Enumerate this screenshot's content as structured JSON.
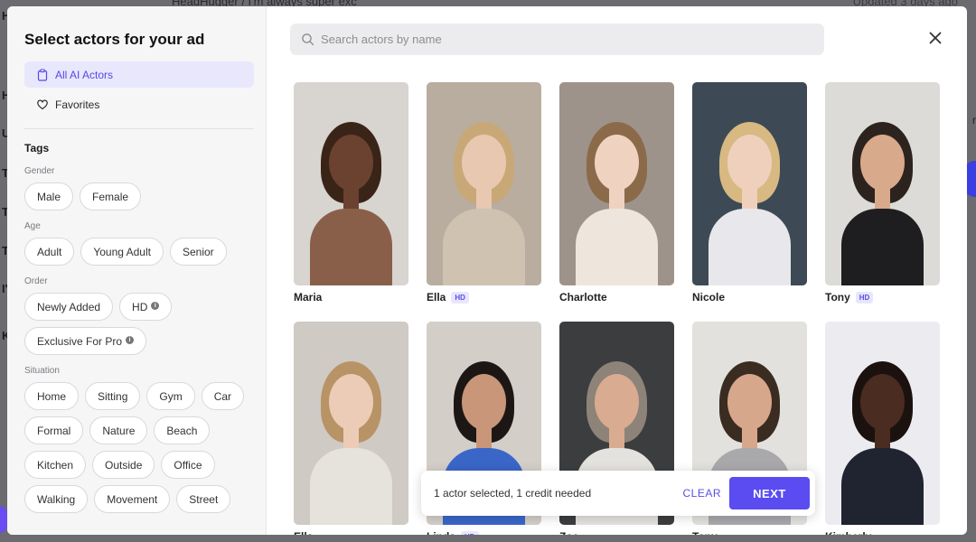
{
  "backdrop": {
    "breadcrumb": "HeadHugger  /  I'm always super exc",
    "updated": "Updated 3 days ago",
    "letters": [
      "H",
      "H",
      "U",
      "T",
      "T",
      "T",
      "I'",
      "K"
    ],
    "right_text": "r"
  },
  "modal": {
    "title": "Select actors for your ad",
    "nav": [
      {
        "label": "All AI Actors",
        "icon": "clipboard-icon",
        "active": true
      },
      {
        "label": "Favorites",
        "icon": "heart-icon",
        "active": false
      }
    ],
    "tags_title": "Tags",
    "groups": [
      {
        "label": "Gender",
        "chips": [
          {
            "text": "Male"
          },
          {
            "text": "Female"
          }
        ]
      },
      {
        "label": "Age",
        "chips": [
          {
            "text": "Adult"
          },
          {
            "text": "Young Adult"
          },
          {
            "text": "Senior"
          }
        ]
      },
      {
        "label": "Order",
        "chips": [
          {
            "text": "Newly Added"
          },
          {
            "text": "HD",
            "info": true
          },
          {
            "text": "Exclusive For Pro",
            "info": true
          }
        ]
      },
      {
        "label": "Situation",
        "chips": [
          {
            "text": "Home"
          },
          {
            "text": "Sitting"
          },
          {
            "text": "Gym"
          },
          {
            "text": "Car"
          },
          {
            "text": "Formal"
          },
          {
            "text": "Nature"
          },
          {
            "text": "Beach"
          },
          {
            "text": "Kitchen"
          },
          {
            "text": "Outside"
          },
          {
            "text": "Office"
          },
          {
            "text": "Walking"
          },
          {
            "text": "Movement"
          },
          {
            "text": "Street"
          }
        ]
      }
    ],
    "search": {
      "placeholder": "Search actors by name",
      "value": ""
    },
    "actors": [
      {
        "name": "Maria",
        "hd": false,
        "bg": "#d8d4d0",
        "skin": "#6b4230",
        "hair": "#3a2418",
        "shirt": "#8a5f4a"
      },
      {
        "name": "Ella",
        "hd": true,
        "bg": "#b9ada0",
        "skin": "#e8c8b0",
        "hair": "#c9a877",
        "shirt": "#cfc2b0"
      },
      {
        "name": "Charlotte",
        "hd": false,
        "bg": "#9e938b",
        "skin": "#f0d2c0",
        "hair": "#8b6a4a",
        "shirt": "#eee6dc"
      },
      {
        "name": "Nicole",
        "hd": false,
        "bg": "#3d4a55",
        "skin": "#efd0bc",
        "hair": "#d8b982",
        "shirt": "#e8e8ec"
      },
      {
        "name": "Tony",
        "hd": true,
        "bg": "#dcdbd8",
        "skin": "#d9a98c",
        "hair": "#2c231e",
        "shirt": "#1e1e20"
      },
      {
        "name": "Ella",
        "hd": false,
        "bg": "#cfcac4",
        "skin": "#ecccb6",
        "hair": "#b89366",
        "shirt": "#e6e2dc"
      },
      {
        "name": "Linda",
        "hd": true,
        "bg": "#d3cec8",
        "skin": "#c99679",
        "hair": "#1c1714",
        "shirt": "#3a66c8"
      },
      {
        "name": "Zoe",
        "hd": false,
        "bg": "#3b3d3f",
        "skin": "#d9ab90",
        "hair": "#8d8378",
        "shirt": "#e4e2de"
      },
      {
        "name": "Tony",
        "hd": false,
        "bg": "#e2e1de",
        "skin": "#d7a78c",
        "hair": "#3b2c22",
        "shirt": "#a9a9ac"
      },
      {
        "name": "Kimberly",
        "hd": false,
        "bg": "#ecebf0",
        "skin": "#4a2c20",
        "hair": "#1b1210",
        "shirt": "#1f2430"
      }
    ],
    "selection": {
      "text": "1 actor selected, 1 credit needed",
      "clear": "CLEAR",
      "next": "NEXT"
    }
  }
}
